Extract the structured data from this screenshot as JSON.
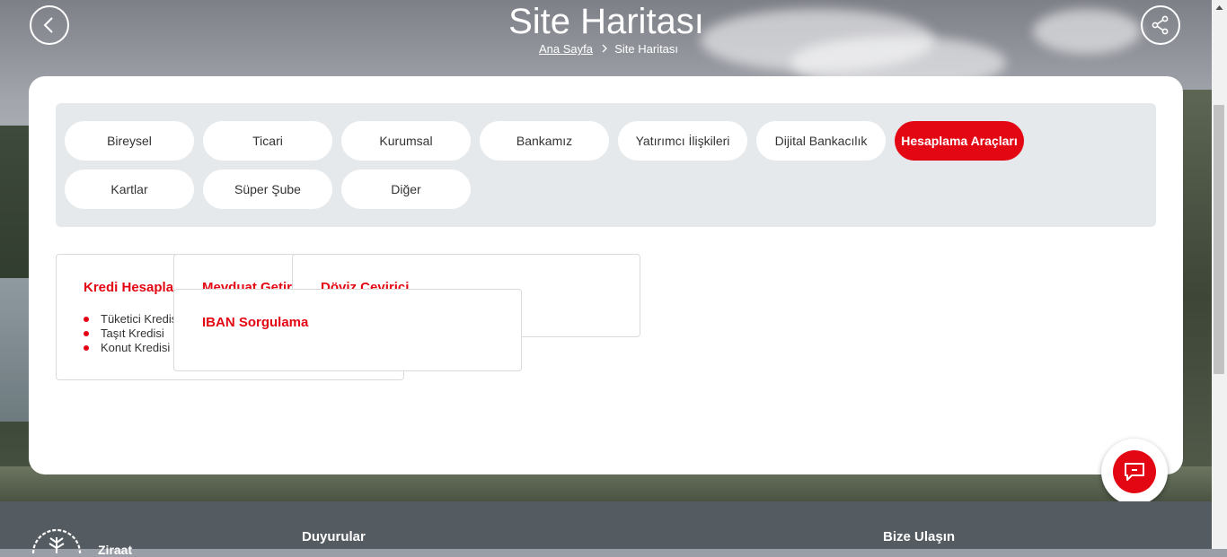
{
  "header": {
    "title": "Site Haritası",
    "breadcrumb": {
      "home": "Ana Sayfa",
      "current": "Site Haritası"
    }
  },
  "tabs": [
    {
      "label": "Bireysel",
      "active": false
    },
    {
      "label": "Ticari",
      "active": false
    },
    {
      "label": "Kurumsal",
      "active": false
    },
    {
      "label": "Bankamız",
      "active": false
    },
    {
      "label": "Yatırımcı İlişkileri",
      "active": false
    },
    {
      "label": "Dijital Bankacılık",
      "active": false
    },
    {
      "label": "Hesaplama Araçları",
      "active": true
    },
    {
      "label": "Kartlar",
      "active": false
    },
    {
      "label": "Süper Şube",
      "active": false
    },
    {
      "label": "Diğer",
      "active": false
    }
  ],
  "tiles": [
    {
      "title": "Kredi Hesaplama",
      "items": [
        "Tüketici Kredisi",
        "Taşıt Kredisi",
        "Konut Kredisi"
      ]
    },
    {
      "title": "Mevduat Getirisi",
      "items": []
    },
    {
      "title": "Döviz Çevirici",
      "items": []
    },
    {
      "title": "IBAN Sorgulama",
      "items": []
    }
  ],
  "footer": {
    "brand": "Ziraat",
    "col1": "Duyurular",
    "col2": "Bize Ulaşın"
  },
  "colors": {
    "accent": "#e30613",
    "footer": "#545b61",
    "panel": "#e6e9eb"
  },
  "icons": {
    "back": "chevron-left-icon",
    "share": "share-icon",
    "chat": "chat-icon",
    "logo": "ziraat-logo-icon"
  }
}
